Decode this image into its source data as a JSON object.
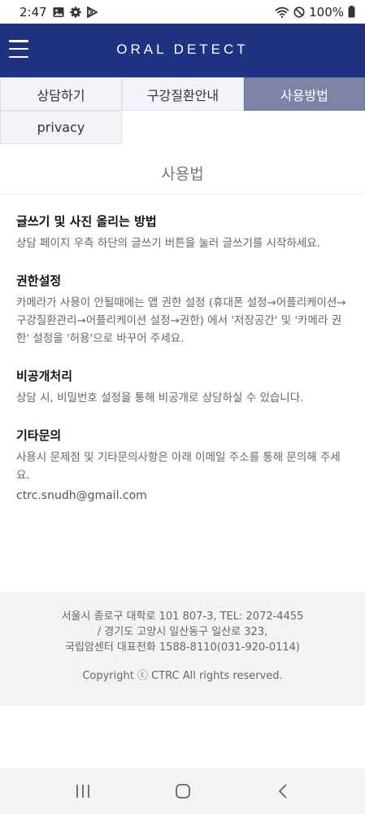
{
  "status_bar": {
    "time": "2:47",
    "battery": "100%"
  },
  "header": {
    "title": "ORAL DETECT"
  },
  "tabs": [
    {
      "label": "상담하기",
      "active": false
    },
    {
      "label": "구강질환안내",
      "active": false
    },
    {
      "label": "사용방법",
      "active": true
    },
    {
      "label": "privacy",
      "active": false
    }
  ],
  "page": {
    "title": "사용법",
    "sections": [
      {
        "heading": "글쓰기 및 사진 올리는 방법",
        "body": "상담 페이지 우측 하단의 글쓰기 버튼을 눌러 글쓰기를 시작하세요."
      },
      {
        "heading": "권한설정",
        "body": "카메라가 사용이 안될때에는 앱 권한 설정 (휴대폰 설정→어플리케이션→구강질환관리→어플리케이션 설정→권한) 에서 '저장공간' 및 '카메라 권한' 설정을 '허용'으로 바꾸어 주세요."
      },
      {
        "heading": "비공개처리",
        "body": "상담 시, 비밀번호 설정을 통해 비공개로 상담하실 수 있습니다."
      },
      {
        "heading": "기타문의",
        "body": "사용시 문제점 및 기타문의사항은 아래 이메일 주소를 통해 문의해 주세요.",
        "email": "ctrc.snudh@gmail.com"
      }
    ]
  },
  "footer": {
    "line1": "서울시 종로구 대학로 101 807-3,  TEL: 2072-4455",
    "line2": "/ 경기도 고양시 일산동구 일산로 323,",
    "line3": "국립암센터 대표전화 1588-8110(031-920-0114)",
    "copyright": "Copyright ⓒ CTRC All rights reserved."
  },
  "colors": {
    "header_bg": "#1f3281",
    "active_tab_bg": "#7d84a7"
  }
}
